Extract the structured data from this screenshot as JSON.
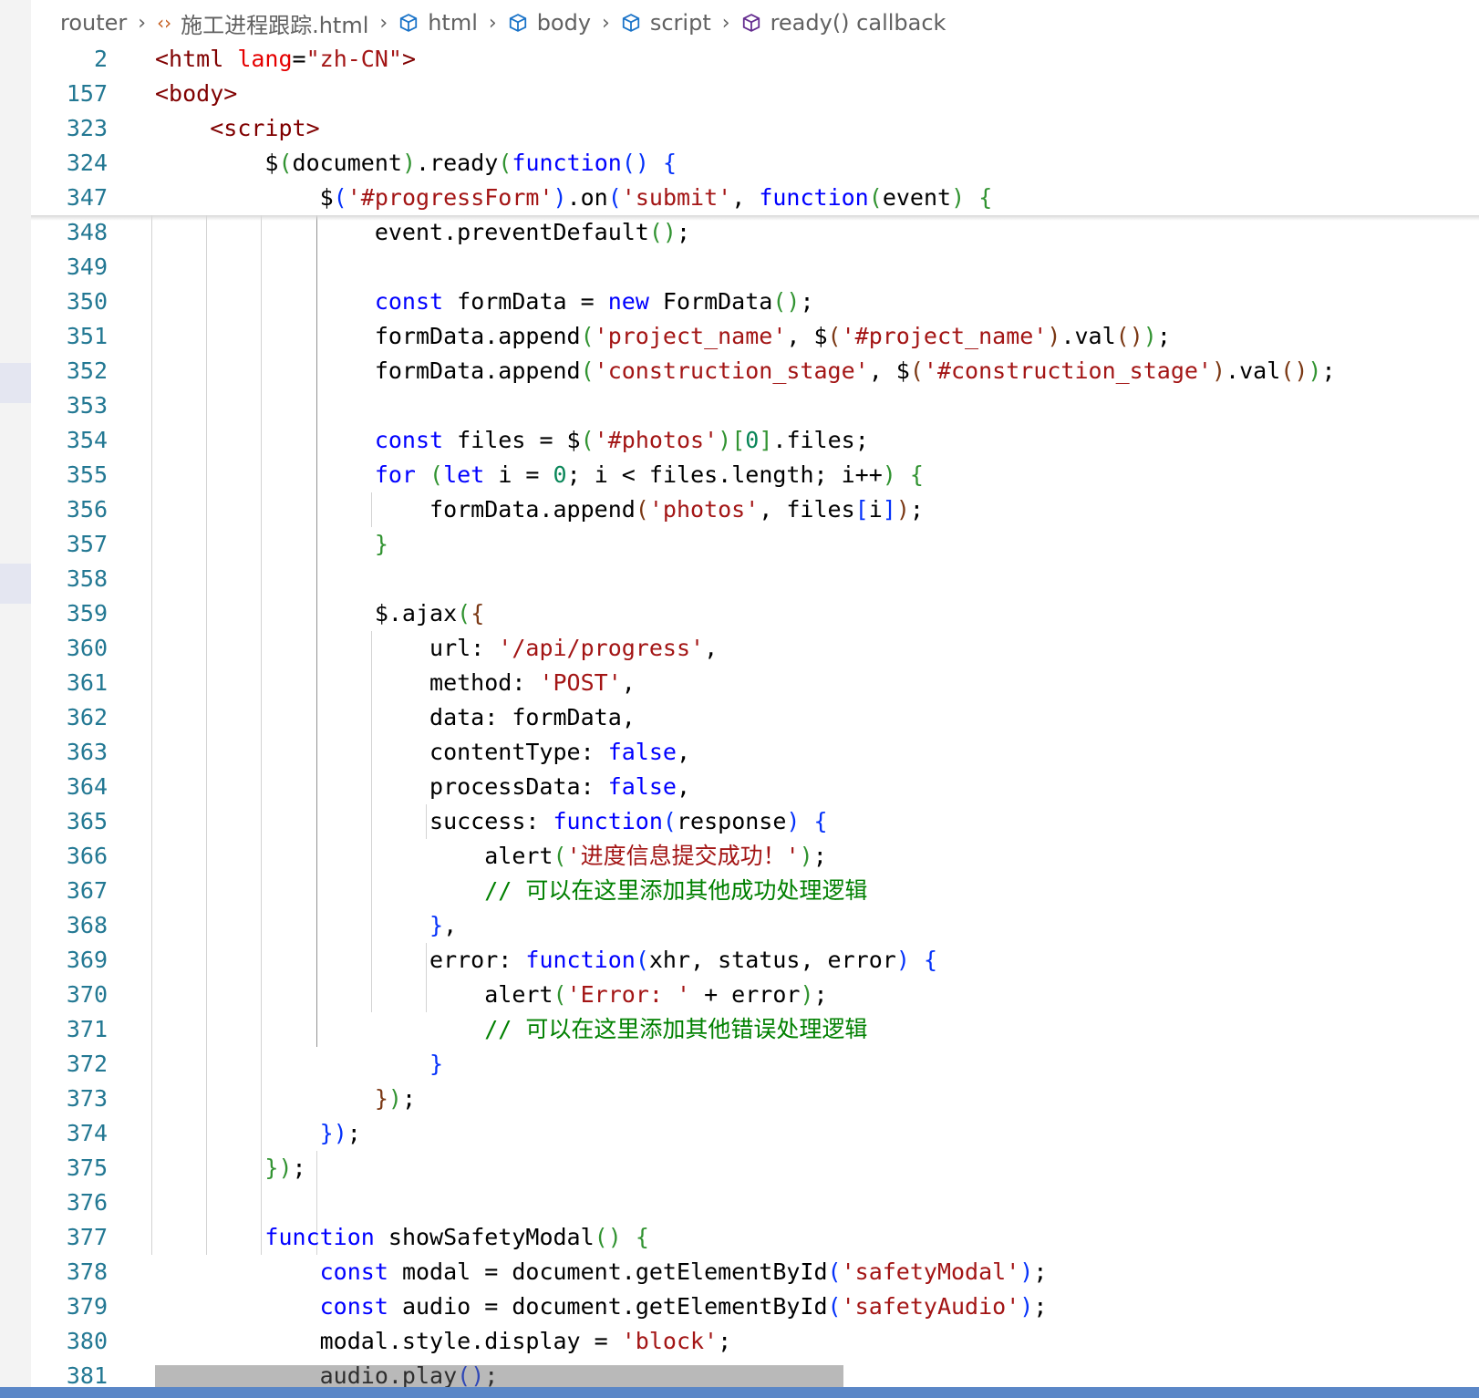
{
  "breadcrumb": {
    "items": [
      {
        "label": "router"
      },
      {
        "label": "施工进程跟踪.html"
      },
      {
        "label": "html"
      },
      {
        "label": "body"
      },
      {
        "label": "script"
      },
      {
        "label": "ready() callback"
      }
    ]
  },
  "editor": {
    "sticky_lines": [
      {
        "num": "2",
        "tokens": [
          [
            "t",
            "<html"
          ],
          [
            "",
            ""
          ],
          [
            "a",
            " lang"
          ],
          [
            "",
            "="
          ],
          [
            "s",
            "\"zh-CN\""
          ],
          [
            "t",
            ">"
          ]
        ]
      },
      {
        "num": "157",
        "tokens": [
          [
            "t",
            "<body>"
          ]
        ]
      },
      {
        "num": "323",
        "tokens": [
          [
            "",
            "    "
          ],
          [
            "t",
            "<script>"
          ]
        ]
      },
      {
        "num": "324",
        "tokens": [
          [
            "",
            "        $"
          ],
          [
            "py",
            "("
          ],
          [
            "",
            "document"
          ],
          [
            "py",
            ")"
          ],
          [
            "",
            ".ready"
          ],
          [
            "py",
            "("
          ],
          [
            "k",
            "function"
          ],
          [
            "pb",
            "()"
          ],
          [
            "",
            " "
          ],
          [
            "pb",
            "{"
          ]
        ]
      },
      {
        "num": "347",
        "tokens": [
          [
            "",
            "            $"
          ],
          [
            "pb",
            "("
          ],
          [
            "s",
            "'#progressForm'"
          ],
          [
            "pb",
            ")"
          ],
          [
            "",
            ".on"
          ],
          [
            "pb",
            "("
          ],
          [
            "s",
            "'submit'"
          ],
          [
            "",
            ", "
          ],
          [
            "k",
            "function"
          ],
          [
            "py",
            "("
          ],
          [
            "",
            "event"
          ],
          [
            "py",
            ")"
          ],
          [
            "",
            " "
          ],
          [
            "py",
            "{"
          ]
        ]
      }
    ],
    "lines": [
      {
        "num": "348",
        "tokens": [
          [
            "",
            "                event.preventDefault"
          ],
          [
            "py",
            "()"
          ],
          [
            "",
            ";"
          ]
        ]
      },
      {
        "num": "349",
        "tokens": []
      },
      {
        "num": "350",
        "tokens": [
          [
            "",
            "                "
          ],
          [
            "k",
            "const"
          ],
          [
            "",
            " formData = "
          ],
          [
            "k",
            "new"
          ],
          [
            "",
            " FormData"
          ],
          [
            "py",
            "()"
          ],
          [
            "",
            ";"
          ]
        ]
      },
      {
        "num": "351",
        "tokens": [
          [
            "",
            "                formData.append"
          ],
          [
            "py",
            "("
          ],
          [
            "s",
            "'project_name'"
          ],
          [
            "",
            ", $"
          ],
          [
            "pp",
            "("
          ],
          [
            "s",
            "'#project_name'"
          ],
          [
            "pp",
            ")"
          ],
          [
            "",
            ".val"
          ],
          [
            "pp",
            "()"
          ],
          [
            "py",
            ")"
          ],
          [
            "",
            ";"
          ]
        ]
      },
      {
        "num": "352",
        "tokens": [
          [
            "",
            "                formData.append"
          ],
          [
            "py",
            "("
          ],
          [
            "s",
            "'construction_stage'"
          ],
          [
            "",
            ", $"
          ],
          [
            "pp",
            "("
          ],
          [
            "s",
            "'#construction_stage'"
          ],
          [
            "pp",
            ")"
          ],
          [
            "",
            ".val"
          ],
          [
            "pp",
            "()"
          ],
          [
            "py",
            ")"
          ],
          [
            "",
            ";"
          ]
        ]
      },
      {
        "num": "353",
        "tokens": []
      },
      {
        "num": "354",
        "tokens": [
          [
            "",
            "                "
          ],
          [
            "k",
            "const"
          ],
          [
            "",
            " files = $"
          ],
          [
            "py",
            "("
          ],
          [
            "s",
            "'#photos'"
          ],
          [
            "py",
            ")"
          ],
          [
            "py",
            "["
          ],
          [
            "n",
            "0"
          ],
          [
            "py",
            "]"
          ],
          [
            "",
            ".files;"
          ]
        ]
      },
      {
        "num": "355",
        "tokens": [
          [
            "",
            "                "
          ],
          [
            "k",
            "for"
          ],
          [
            "",
            " "
          ],
          [
            "py",
            "("
          ],
          [
            "k",
            "let"
          ],
          [
            "",
            " i = "
          ],
          [
            "n",
            "0"
          ],
          [
            "",
            ";"
          ],
          [
            "",
            " i < files.length; i++"
          ],
          [
            "py",
            ")"
          ],
          [
            "",
            " "
          ],
          [
            "py",
            "{"
          ]
        ]
      },
      {
        "num": "356",
        "tokens": [
          [
            "",
            "                    formData.append"
          ],
          [
            "pp",
            "("
          ],
          [
            "s",
            "'photos'"
          ],
          [
            "",
            ", files"
          ],
          [
            "pb",
            "["
          ],
          [
            "",
            "i"
          ],
          [
            "pb",
            "]"
          ],
          [
            "pp",
            ")"
          ],
          [
            "",
            ";"
          ]
        ]
      },
      {
        "num": "357",
        "tokens": [
          [
            "",
            "                "
          ],
          [
            "py",
            "}"
          ]
        ]
      },
      {
        "num": "358",
        "tokens": []
      },
      {
        "num": "359",
        "tokens": [
          [
            "",
            "                $.ajax"
          ],
          [
            "py",
            "("
          ],
          [
            "pp",
            "{"
          ]
        ]
      },
      {
        "num": "360",
        "tokens": [
          [
            "",
            "                    url: "
          ],
          [
            "s",
            "'/api/progress'"
          ],
          [
            "",
            ","
          ]
        ]
      },
      {
        "num": "361",
        "tokens": [
          [
            "",
            "                    method: "
          ],
          [
            "s",
            "'POST'"
          ],
          [
            "",
            ","
          ]
        ]
      },
      {
        "num": "362",
        "tokens": [
          [
            "",
            "                    data: formData,"
          ]
        ]
      },
      {
        "num": "363",
        "tokens": [
          [
            "",
            "                    contentType: "
          ],
          [
            "k",
            "false"
          ],
          [
            "",
            ","
          ]
        ]
      },
      {
        "num": "364",
        "tokens": [
          [
            "",
            "                    processData: "
          ],
          [
            "k",
            "false"
          ],
          [
            "",
            ","
          ]
        ]
      },
      {
        "num": "365",
        "tokens": [
          [
            "",
            "                    success: "
          ],
          [
            "k",
            "function"
          ],
          [
            "pb",
            "("
          ],
          [
            "",
            "response"
          ],
          [
            "pb",
            ")"
          ],
          [
            "",
            " "
          ],
          [
            "pb",
            "{"
          ]
        ]
      },
      {
        "num": "366",
        "tokens": [
          [
            "",
            "                        alert"
          ],
          [
            "py",
            "("
          ],
          [
            "s",
            "'进度信息提交成功！'"
          ],
          [
            "py",
            ")"
          ],
          [
            "",
            ";"
          ]
        ]
      },
      {
        "num": "367",
        "tokens": [
          [
            "",
            "                        "
          ],
          [
            "c",
            "// 可以在这里添加其他成功处理逻辑"
          ]
        ]
      },
      {
        "num": "368",
        "tokens": [
          [
            "",
            "                    "
          ],
          [
            "pb",
            "}"
          ],
          [
            "",
            ","
          ]
        ]
      },
      {
        "num": "369",
        "tokens": [
          [
            "",
            "                    error: "
          ],
          [
            "k",
            "function"
          ],
          [
            "pb",
            "("
          ],
          [
            "",
            "xhr, status, error"
          ],
          [
            "pb",
            ")"
          ],
          [
            "",
            " "
          ],
          [
            "pb",
            "{"
          ]
        ]
      },
      {
        "num": "370",
        "tokens": [
          [
            "",
            "                        alert"
          ],
          [
            "py",
            "("
          ],
          [
            "s",
            "'Error: '"
          ],
          [
            "",
            " + error"
          ],
          [
            "py",
            ")"
          ],
          [
            "",
            ";"
          ]
        ]
      },
      {
        "num": "371",
        "tokens": [
          [
            "",
            "                        "
          ],
          [
            "c",
            "// 可以在这里添加其他错误处理逻辑"
          ]
        ]
      },
      {
        "num": "372",
        "tokens": [
          [
            "",
            "                    "
          ],
          [
            "pb",
            "}"
          ]
        ]
      },
      {
        "num": "373",
        "tokens": [
          [
            "",
            "                "
          ],
          [
            "pp",
            "}"
          ],
          [
            "py",
            ")"
          ],
          [
            "",
            ";"
          ]
        ]
      },
      {
        "num": "374",
        "tokens": [
          [
            "",
            "            "
          ],
          [
            "pb",
            "}"
          ],
          [
            "pb",
            ")"
          ],
          [
            "",
            ";"
          ]
        ]
      },
      {
        "num": "375",
        "tokens": [
          [
            "",
            "        "
          ],
          [
            "py",
            "}"
          ],
          [
            "py",
            ")"
          ],
          [
            "",
            ";"
          ]
        ]
      },
      {
        "num": "376",
        "tokens": []
      },
      {
        "num": "377",
        "tokens": [
          [
            "",
            "        "
          ],
          [
            "k",
            "function"
          ],
          [
            "",
            " showSafetyModal"
          ],
          [
            "py",
            "()"
          ],
          [
            "",
            " "
          ],
          [
            "py",
            "{"
          ]
        ]
      },
      {
        "num": "378",
        "tokens": [
          [
            "",
            "            "
          ],
          [
            "k",
            "const"
          ],
          [
            "",
            " modal = document.getElementById"
          ],
          [
            "pb",
            "("
          ],
          [
            "s",
            "'safetyModal'"
          ],
          [
            "pb",
            ")"
          ],
          [
            "",
            ";"
          ]
        ]
      },
      {
        "num": "379",
        "tokens": [
          [
            "",
            "            "
          ],
          [
            "k",
            "const"
          ],
          [
            "",
            " audio = document.getElementById"
          ],
          [
            "pb",
            "("
          ],
          [
            "s",
            "'safetyAudio'"
          ],
          [
            "pb",
            ")"
          ],
          [
            "",
            ";"
          ]
        ]
      },
      {
        "num": "380",
        "tokens": [
          [
            "",
            "            modal.style.display = "
          ],
          [
            "s",
            "'block'"
          ],
          [
            "",
            ";"
          ]
        ]
      },
      {
        "num": "381",
        "tokens": [
          [
            "",
            "            audio.play"
          ],
          [
            "pb",
            "()"
          ],
          [
            "",
            ";"
          ]
        ]
      }
    ]
  }
}
